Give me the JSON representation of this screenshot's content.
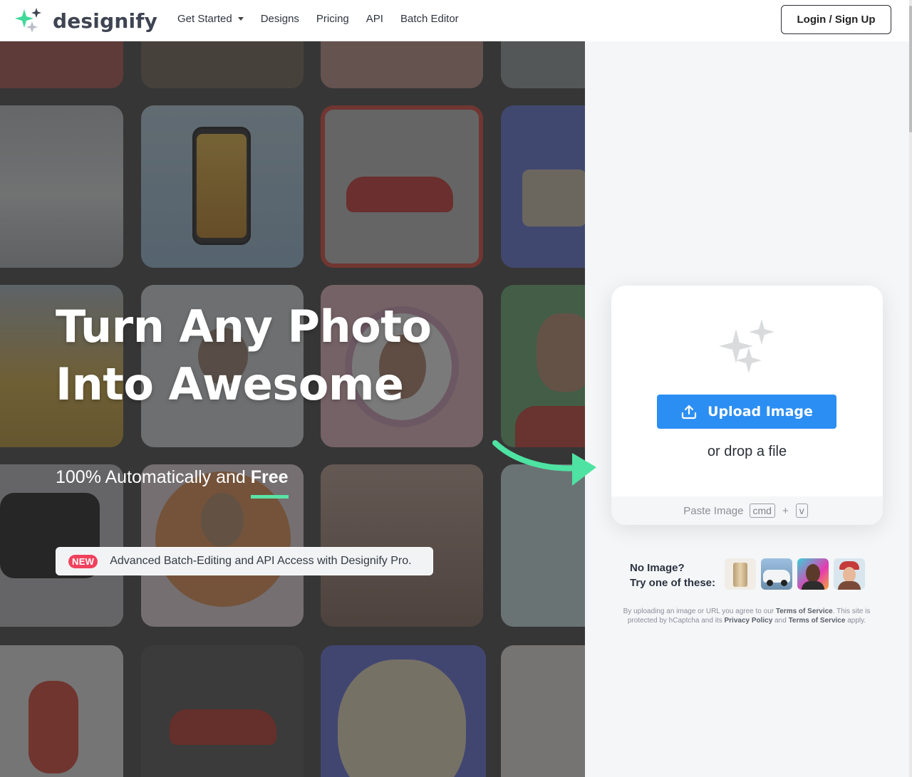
{
  "nav": {
    "logo_text": "designify",
    "links": [
      {
        "label": "Get Started",
        "has_dropdown": true
      },
      {
        "label": "Designs"
      },
      {
        "label": "Pricing"
      },
      {
        "label": "API"
      },
      {
        "label": "Batch Editor"
      }
    ],
    "login_label": "Login / Sign Up"
  },
  "hero": {
    "title_line1": "Turn Any Photo",
    "title_line2": "Into Awesome",
    "subtitle_prefix": "100% Automatically and ",
    "subtitle_emphasis": "Free",
    "new_badge": "NEW",
    "new_text": "Advanced Batch-Editing and API Access with Designify Pro."
  },
  "upload": {
    "button_label": "Upload Image",
    "drop_text": "or drop a file",
    "paste_label": "Paste Image",
    "key_cmd": "cmd",
    "key_plus": "+",
    "key_v": "v"
  },
  "samples": {
    "label_line1": "No Image?",
    "label_line2": "Try one of these:",
    "items": [
      "sample-cup",
      "sample-car",
      "sample-man",
      "sample-woman"
    ]
  },
  "legal": {
    "text1": "By uploading an image or URL you agree to our ",
    "tos": "Terms of Service",
    "text2": ". This site is protected by hCaptcha and its ",
    "privacy": "Privacy Policy",
    "text3": " and ",
    "tos2": "Terms of Service",
    "text4": " apply."
  },
  "colors": {
    "brand_green": "#5ae3a5",
    "upload_blue": "#2b8ef3",
    "new_badge_red": "#f0425d"
  }
}
